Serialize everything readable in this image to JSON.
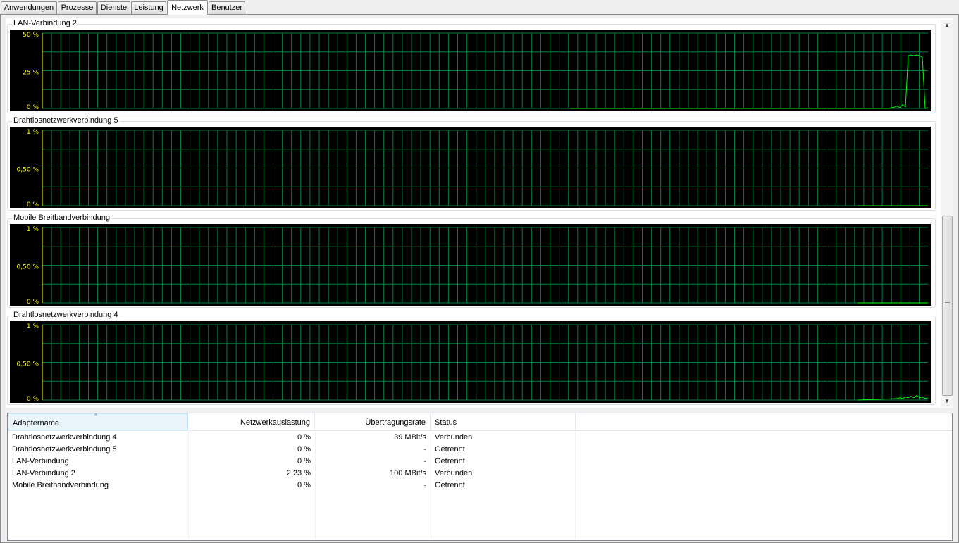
{
  "tabs": [
    {
      "label": "Anwendungen",
      "active": false
    },
    {
      "label": "Prozesse",
      "active": false
    },
    {
      "label": "Dienste",
      "active": false
    },
    {
      "label": "Leistung",
      "active": false
    },
    {
      "label": "Netzwerk",
      "active": true
    },
    {
      "label": "Benutzer",
      "active": false
    }
  ],
  "graphs": [
    {
      "title": "LAN-Verbindung 2",
      "y_labels": [
        "50 %",
        "25 %",
        "0 %"
      ],
      "y_max_percent": 50,
      "series_percent": [
        0,
        0,
        0,
        0,
        0,
        0,
        0,
        0,
        0,
        0,
        0,
        0,
        0,
        0,
        0,
        0,
        0,
        0,
        0,
        0,
        0,
        0,
        0,
        0,
        0,
        0,
        0,
        0,
        0,
        0,
        0,
        0,
        0,
        0,
        0,
        0,
        0,
        0,
        0,
        0,
        0,
        0,
        0,
        0,
        0,
        0,
        0,
        0,
        0,
        0,
        0,
        0,
        0,
        0,
        0,
        0,
        0,
        0,
        0,
        0,
        0,
        0,
        0,
        0,
        0,
        0,
        0,
        0,
        0,
        0,
        0,
        0,
        0,
        0,
        0,
        0,
        0,
        0,
        0,
        0,
        0,
        0,
        0,
        0,
        0,
        0,
        0,
        0,
        0,
        0,
        0,
        0,
        0,
        0,
        0,
        0,
        0,
        0,
        0,
        0,
        0,
        0,
        0,
        0,
        0,
        0,
        0,
        0,
        0,
        0,
        0,
        0,
        0,
        0,
        0.5,
        0.8,
        1.5,
        0.6,
        2.5,
        1.0,
        35,
        35.5,
        35,
        35.5,
        35,
        34,
        0,
        0.5
      ]
    },
    {
      "title": "Drahtlosnetzwerkverbindung 5",
      "y_labels": [
        "1 %",
        "0,50 %",
        "0 %"
      ],
      "y_max_percent": 1,
      "series_percent": [
        0,
        0,
        0,
        0,
        0,
        0,
        0,
        0,
        0,
        0
      ]
    },
    {
      "title": "Mobile Breitbandverbindung",
      "y_labels": [
        "1 %",
        "0,50 %",
        "0 %"
      ],
      "y_max_percent": 1,
      "series_percent": [
        0,
        0,
        0,
        0,
        0,
        0,
        0,
        0,
        0,
        0
      ]
    },
    {
      "title": "Drahtlosnetzwerkverbindung 4",
      "y_labels": [
        "1 %",
        "0,50 %",
        "0 %"
      ],
      "y_max_percent": 1,
      "series_percent": [
        0.02,
        0.03,
        0.02,
        0.04,
        0.03,
        0.05,
        0.03,
        0.06,
        0.03,
        0.04,
        0.02,
        0.03
      ]
    }
  ],
  "colors": {
    "graph_bg": "#000000",
    "grid": "#008040",
    "series": "#00ff00",
    "label": "#ffff00"
  },
  "table": {
    "columns": [
      {
        "label": "Adaptername",
        "sorted": true
      },
      {
        "label": "Netzwerkauslastung",
        "sorted": false
      },
      {
        "label": "Übertragungsrate",
        "sorted": false
      },
      {
        "label": "Status",
        "sorted": false
      }
    ],
    "sort_indicator": "^",
    "rows": [
      {
        "name": "Drahtlosnetzwerkverbindung 4",
        "usage": "0 %",
        "rate": "39 MBit/s",
        "status": "Verbunden"
      },
      {
        "name": "Drahtlosnetzwerkverbindung 5",
        "usage": "0 %",
        "rate": "-",
        "status": "Getrennt"
      },
      {
        "name": "LAN-Verbindung",
        "usage": "0 %",
        "rate": "-",
        "status": "Getrennt"
      },
      {
        "name": "LAN-Verbindung 2",
        "usage": "2,23 %",
        "rate": "100 MBit/s",
        "status": "Verbunden"
      },
      {
        "name": "Mobile Breitbandverbindung",
        "usage": "0 %",
        "rate": "-",
        "status": "Getrennt"
      }
    ]
  },
  "scrollbar": {
    "up_glyph": "▲",
    "down_glyph": "▼"
  }
}
